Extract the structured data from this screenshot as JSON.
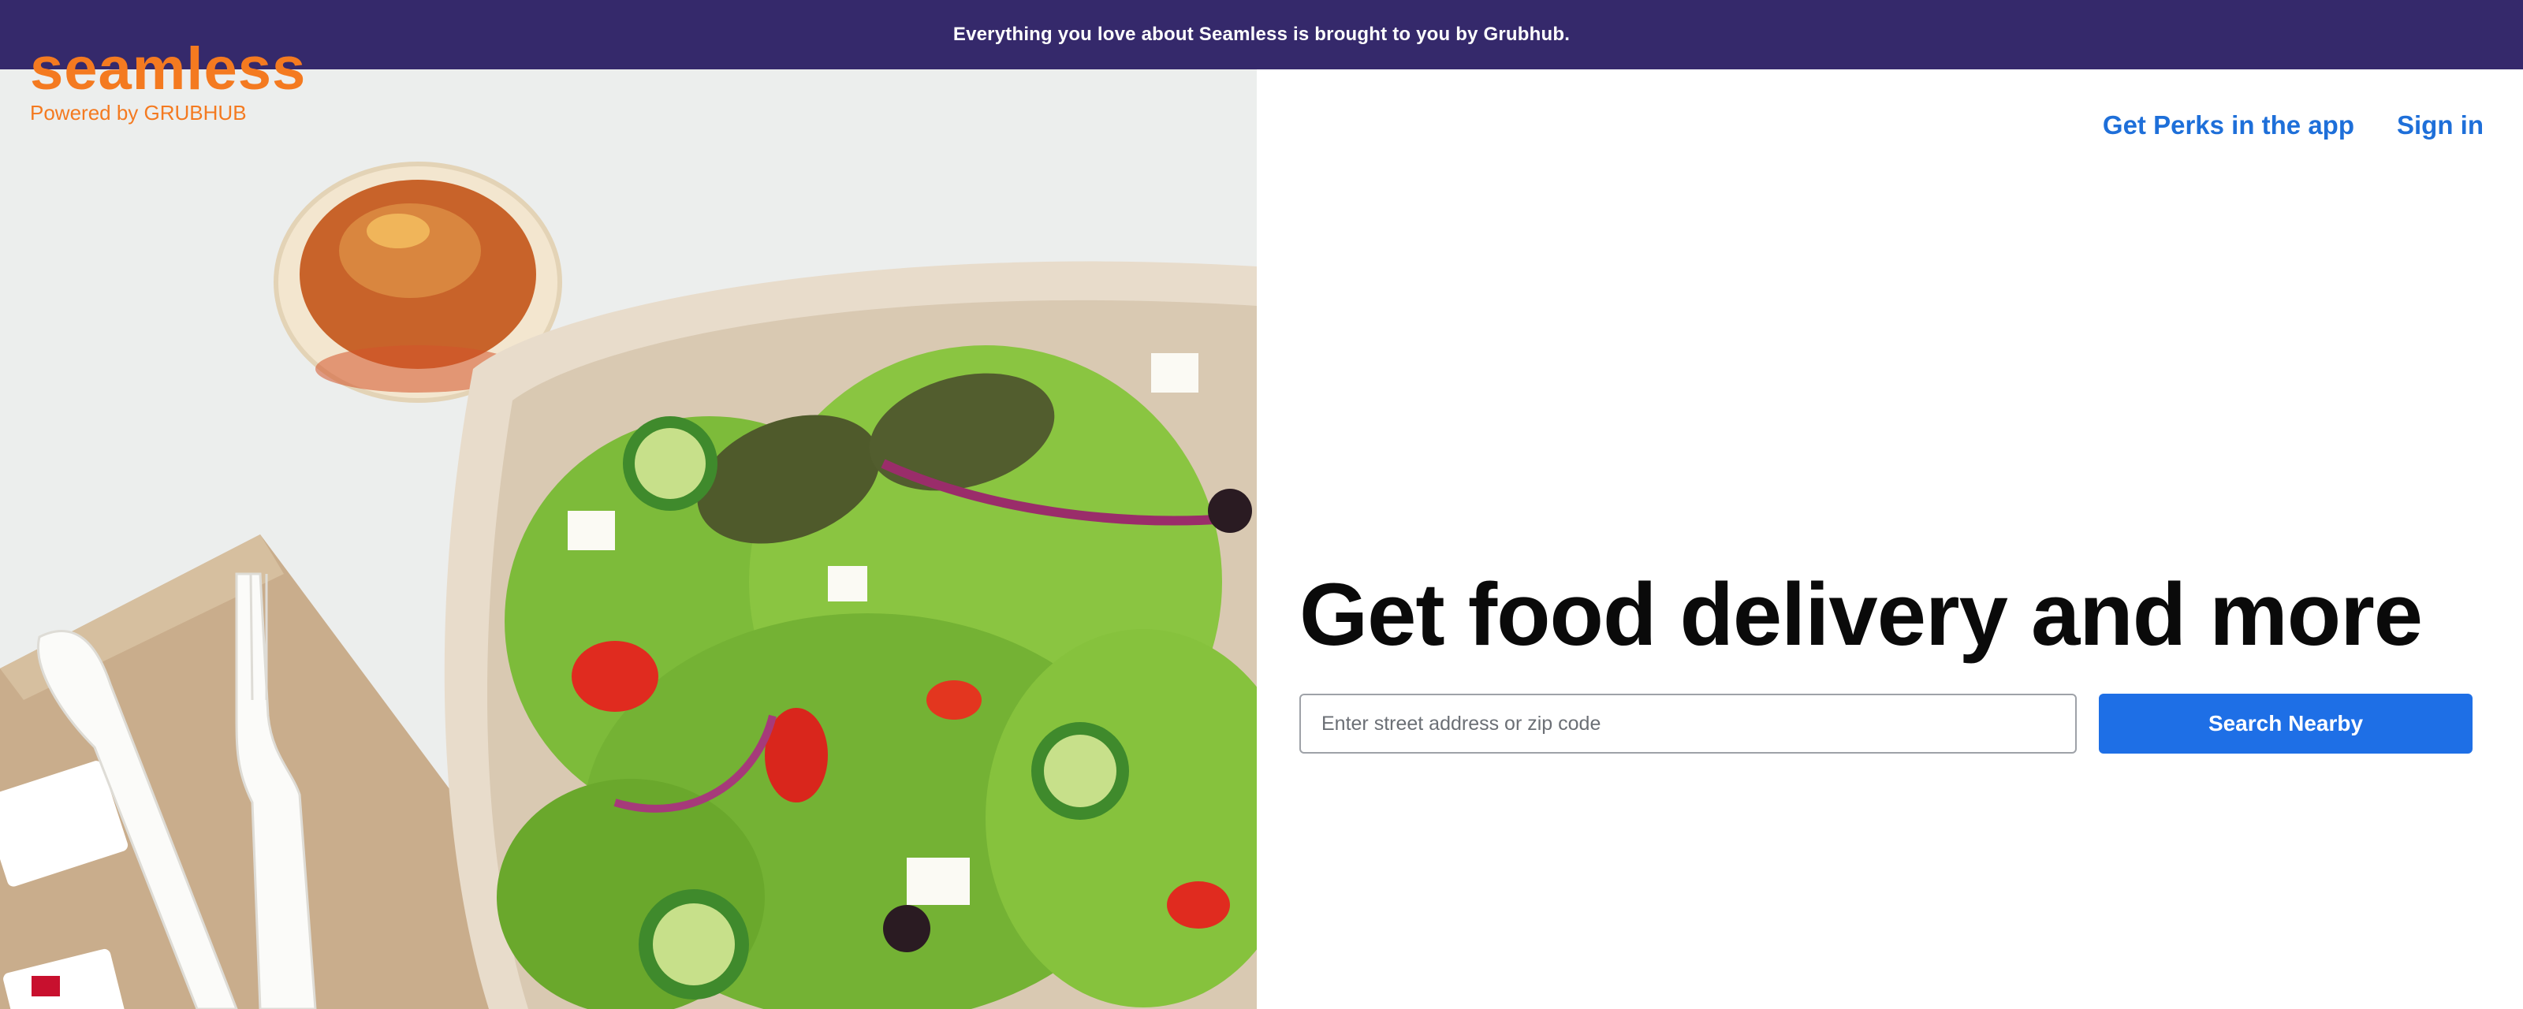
{
  "banner": {
    "text": "Everything you love about Seamless is brought to you by Grubhub."
  },
  "brand": {
    "name": "seamless",
    "tagline": "Powered by GRUBHUB",
    "color": "#f47a20"
  },
  "nav": {
    "perks_label": "Get Perks in the app",
    "signin_label": "Sign in",
    "link_color": "#1e6fd9"
  },
  "hero": {
    "headline": "Get food delivery and more",
    "image_alt": "Greek salad in a takeout bowl with dressing, fork and knife",
    "address_placeholder": "Enter street address or zip code",
    "address_value": "",
    "search_label": "Search Nearby"
  },
  "colors": {
    "banner_bg": "#35296b",
    "button_bg": "#1e6fe6"
  }
}
